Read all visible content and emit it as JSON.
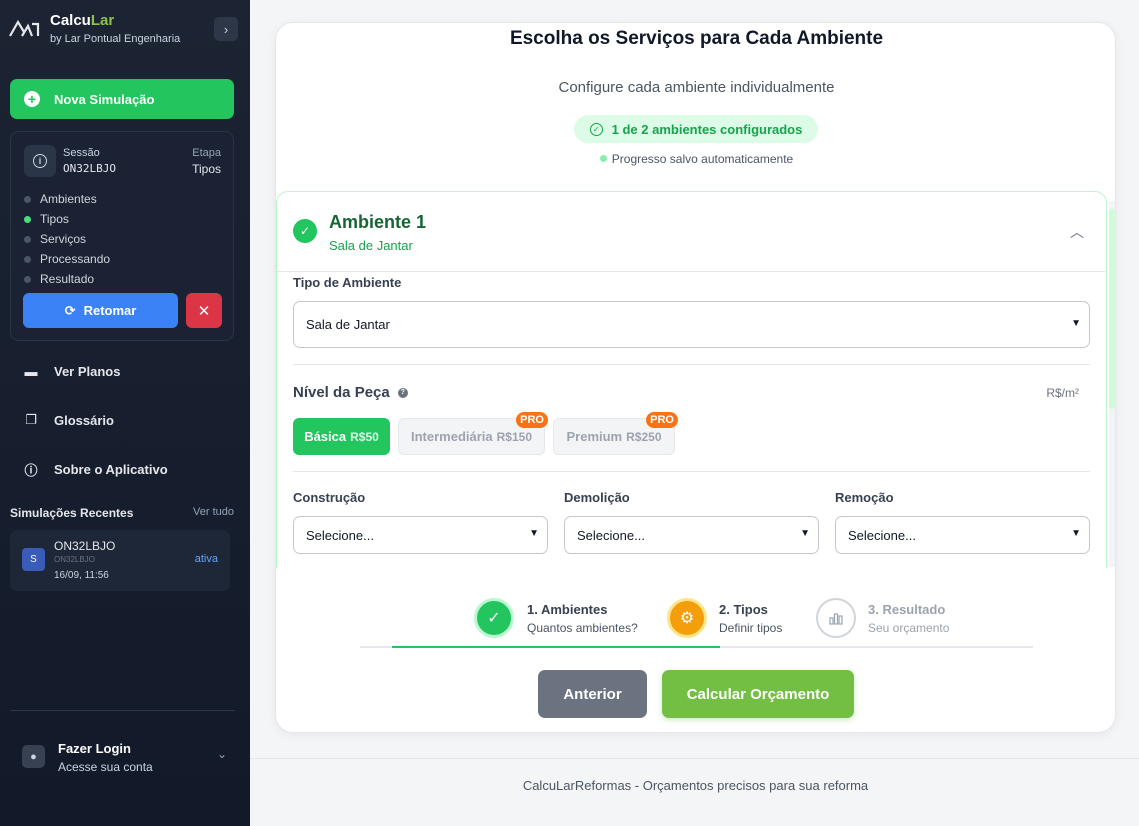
{
  "sidebar": {
    "brand": {
      "name_a": "Calcu",
      "name_b": "Lar",
      "sub": "by Lar Pontual Engenharia"
    },
    "new_sim_label": "Nova Simulação",
    "session": {
      "label": "Sessão",
      "code": "ON32LBJO",
      "stage_label": "Etapa",
      "stage_value": "Tipos",
      "steps": [
        "Ambientes",
        "Tipos",
        "Serviços",
        "Processando",
        "Resultado"
      ],
      "active_step": "Tipos",
      "resume_label": "Retomar"
    },
    "nav": [
      "Ver Planos",
      "Glossário",
      "Sobre o Aplicativo"
    ],
    "recent": {
      "title": "Simulações Recentes",
      "see_all": "Ver tudo",
      "item": {
        "avatar": "S",
        "name": "ON32LBJO",
        "code": "ON32LBJO",
        "date": "16/09, 11:56",
        "status": "ativa"
      }
    },
    "login": {
      "title": "Fazer Login",
      "sub": "Acesse sua conta"
    }
  },
  "main": {
    "title": "Escolha os Serviços para Cada Ambiente",
    "subtitle": "Configure cada ambiente individualmente",
    "badge": "1 de 2 ambientes configurados",
    "saved": "Progresso salvo automaticamente",
    "environment": {
      "title": "Ambiente 1",
      "subtitle": "Sala de Jantar",
      "type_label": "Tipo de Ambiente",
      "type_value": "Sala de Jantar",
      "level_label": "Nível da Peça",
      "unit": "R$/m²",
      "levels": [
        {
          "name": "Básica",
          "price": "R$50",
          "pro": ""
        },
        {
          "name": "Intermediária",
          "price": "R$150",
          "pro": "PRO"
        },
        {
          "name": "Premium",
          "price": "R$250",
          "pro": "PRO"
        }
      ],
      "services": [
        {
          "label": "Construção",
          "value": "Selecione..."
        },
        {
          "label": "Demolição",
          "value": "Selecione..."
        },
        {
          "label": "Remoção",
          "value": "Selecione..."
        }
      ]
    },
    "stepper": [
      {
        "title": "1. Ambientes",
        "sub": "Quantos ambientes?",
        "state": "done"
      },
      {
        "title": "2. Tipos",
        "sub": "Definir tipos",
        "state": "current"
      },
      {
        "title": "3. Resultado",
        "sub": "Seu orçamento",
        "state": "pending"
      }
    ],
    "prev_label": "Anterior",
    "calc_label": "Calcular Orçamento"
  },
  "footer": "CalcuLarReformas - Orçamentos precisos para sua reforma",
  "colors": {
    "primary_green": "#22c55e",
    "brand_green": "#72bf44",
    "blue": "#3b82f6",
    "red": "#dc3545",
    "orange": "#f97316"
  }
}
